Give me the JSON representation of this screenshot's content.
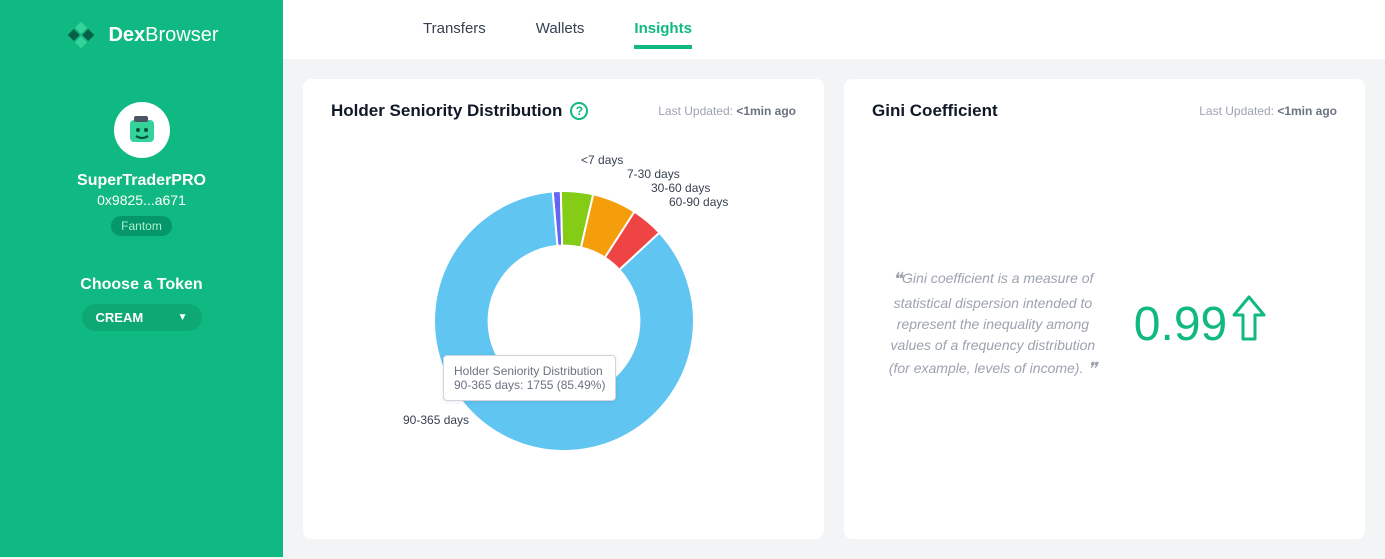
{
  "brand": {
    "bold": "Dex",
    "rest": "Browser"
  },
  "profile": {
    "username": "SuperTraderPRO",
    "address": "0x9825...a671",
    "network": "Fantom"
  },
  "sidebar": {
    "choose_label": "Choose a Token",
    "selected_token": "CREAM"
  },
  "tabs": [
    "Transfers",
    "Wallets",
    "Insights"
  ],
  "active_tab_index": 2,
  "cards": {
    "seniority": {
      "title": "Holder Seniority Distribution",
      "updated_label": "Last Updated:",
      "updated_value": "<1min ago",
      "tooltip_line1": "Holder Seniority Distribution",
      "tooltip_line2": "90-365 days: 1755 (85.49%)",
      "labels": {
        "lt7": "<7 days",
        "d7_30": "7-30 days",
        "d30_60": "30-60 days",
        "d60_90": "60-90 days",
        "d90_365": "90-365 days"
      }
    },
    "gini": {
      "title": "Gini Coefficient",
      "updated_label": "Last Updated:",
      "updated_value": "<1min ago",
      "quote": "Gini coefficient is a measure of statistical dispersion intended to represent the inequality among values of a frequency distribution (for example, levels of income).",
      "value": "0.99",
      "trend": "up"
    }
  },
  "chart_data": {
    "type": "pie",
    "variant": "donut",
    "title": "Holder Seniority Distribution",
    "series": [
      {
        "name": "<7 days",
        "percent": 1.0,
        "color": "#6366f1"
      },
      {
        "name": "7-30 days",
        "percent": 4.0,
        "color": "#84cc16"
      },
      {
        "name": "30-60 days",
        "percent": 5.5,
        "color": "#f59e0b"
      },
      {
        "name": "60-90 days",
        "percent": 4.0,
        "color": "#ef4444"
      },
      {
        "name": "90-365 days",
        "percent": 85.49,
        "count": 1755,
        "color": "#60c5f1"
      }
    ],
    "start_angle_deg": -5,
    "inner_radius_ratio": 0.58
  }
}
